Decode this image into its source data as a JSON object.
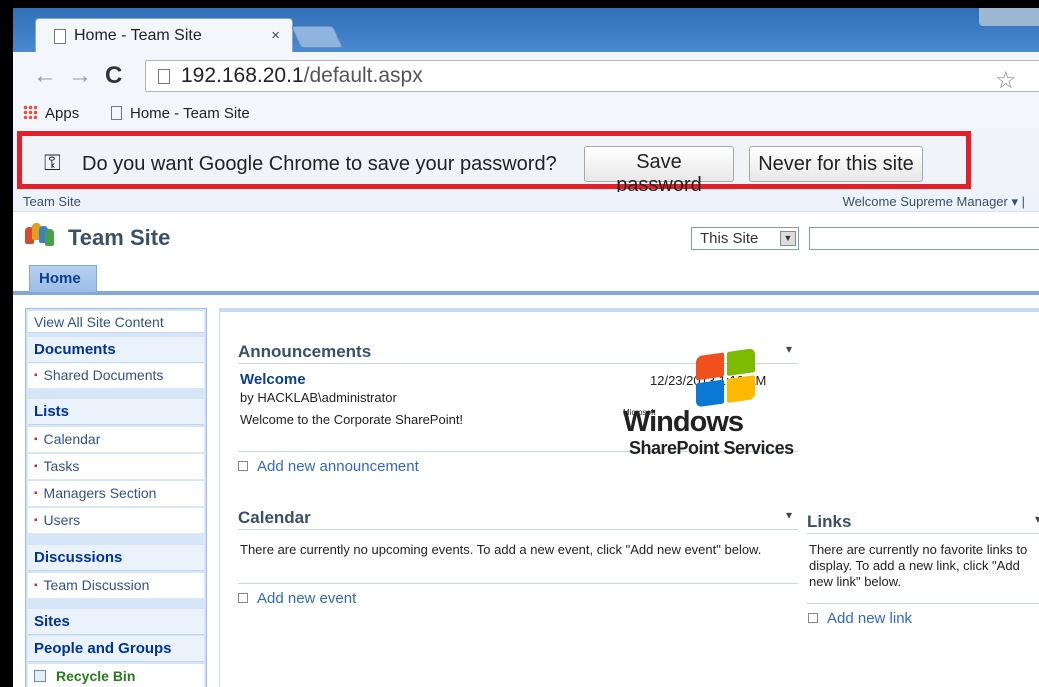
{
  "browser": {
    "tab_title": "Home - Team Site",
    "tab_close": "×",
    "url_host": "192.168.20.1",
    "url_path": "/default.aspx",
    "bookmarks": {
      "apps_label": "Apps",
      "item1_label": "Home - Team Site"
    },
    "password_bar": {
      "question": "Do you want Google Chrome to save your password?",
      "save_label": "Save password",
      "never_label": "Never for this site"
    }
  },
  "sharepoint": {
    "breadcrumb": "Team Site",
    "welcome": "Welcome Supreme Manager ▾  |",
    "site_title": "Team Site",
    "search_scope": "This Site",
    "top_nav": {
      "home": "Home"
    },
    "quick_launch": {
      "view_all": "View All Site Content",
      "documents_header": "Documents",
      "shared_documents": "Shared Documents",
      "lists_header": "Lists",
      "calendar": "Calendar",
      "tasks": "Tasks",
      "managers_section": "Managers Section",
      "users": "Users",
      "discussions_header": "Discussions",
      "team_discussion": "Team Discussion",
      "sites_header": "Sites",
      "people_header": "People and Groups",
      "recycle_bin": "Recycle Bin"
    },
    "announcements": {
      "title": "Announcements",
      "item_title": "Welcome",
      "item_by": "by HACKLAB\\administrator",
      "item_date": "12/23/2013 1:10 AM",
      "item_body": "Welcome to the Corporate SharePoint!",
      "add_link": "Add new announcement"
    },
    "calendar": {
      "title": "Calendar",
      "body": "There are currently no upcoming events. To add a new event, click \"Add new event\" below.",
      "add_link": "Add new event"
    },
    "links": {
      "title": "Links",
      "body": "There are currently no favorite links to display. To add a new link, click \"Add new link\" below.",
      "add_link": "Add new link"
    },
    "logo": {
      "microsoft": "Microsoft",
      "windows": "Windows",
      "sharepoint": "SharePoint Services"
    }
  },
  "colors": {
    "highlight": "#e3202a",
    "sp_blue": "#3b4f6b",
    "link_blue": "#3366cc"
  }
}
